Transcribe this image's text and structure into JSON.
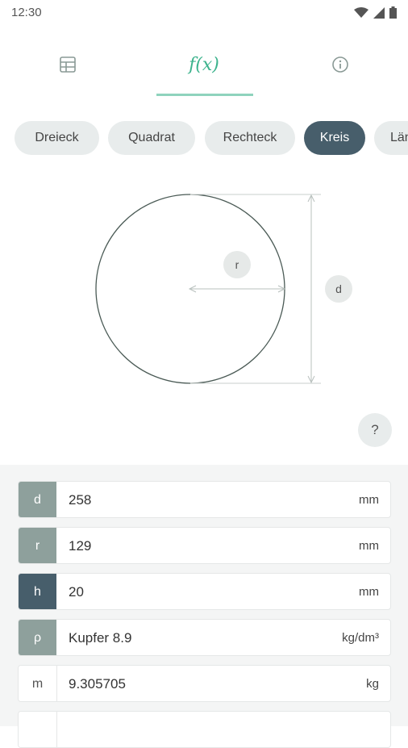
{
  "status": {
    "time": "12:30",
    "icons": [
      "wifi-icon",
      "signal-icon",
      "battery-icon"
    ]
  },
  "tabs": [
    {
      "name": "table",
      "icon": "table-icon"
    },
    {
      "name": "formula",
      "label": "f(x)",
      "active": true
    },
    {
      "name": "info",
      "icon": "info-icon"
    }
  ],
  "shapes": [
    {
      "label": "Dreieck",
      "active": false
    },
    {
      "label": "Quadrat",
      "active": false
    },
    {
      "label": "Rechteck",
      "active": false
    },
    {
      "label": "Kreis",
      "active": true
    },
    {
      "label": "Län",
      "active": false
    }
  ],
  "diagram": {
    "radius_label": "r",
    "diameter_label": "d"
  },
  "help_label": "?",
  "fields": [
    {
      "key": "d",
      "value": "258",
      "unit": "mm"
    },
    {
      "key": "r",
      "value": "129",
      "unit": "mm"
    },
    {
      "key": "h",
      "value": "20",
      "unit": "mm"
    },
    {
      "key": "ρ",
      "value": "Kupfer 8.9",
      "unit": "kg/dm³"
    },
    {
      "key": "m",
      "value": "9.305705",
      "unit": "kg"
    }
  ],
  "colors": {
    "accent": "#3db38d",
    "active_chip": "#475e6b",
    "key_mid": "#8ea09c",
    "key_dark": "#475e6b"
  }
}
